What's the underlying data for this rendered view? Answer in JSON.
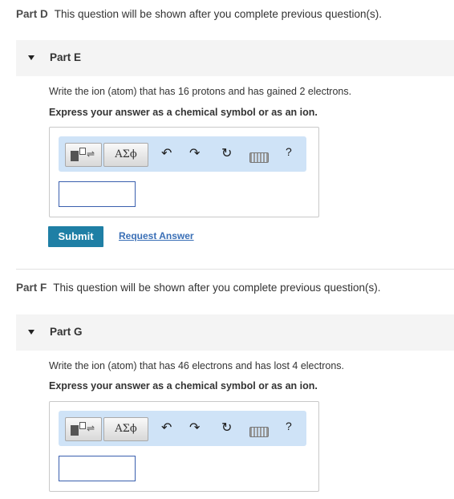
{
  "part_d": {
    "label": "Part D",
    "text": "This question will be shown after you complete previous question(s)."
  },
  "part_e": {
    "label": "Part E",
    "question": "Write the ion (atom) that has 16 protons and has gained 2 electrons.",
    "instruction": "Express your answer as a chemical symbol or as an ion.",
    "answer_value": "",
    "submit_label": "Submit",
    "request_label": "Request Answer"
  },
  "part_f": {
    "label": "Part F",
    "text": "This question will be shown after you complete previous question(s)."
  },
  "part_g": {
    "label": "Part G",
    "question": "Write the ion (atom) that has 46 electrons and has lost 4 electrons.",
    "instruction": "Express your answer as a chemical symbol or as an ion.",
    "answer_value": ""
  },
  "toolbar": {
    "greek_label": "ΑΣϕ",
    "undo_glyph": "↶",
    "redo_glyph": "↷",
    "reset_glyph": "↻",
    "help_label": "?",
    "icons": [
      "templates-icon",
      "greek-icon",
      "undo-icon",
      "redo-icon",
      "reset-icon",
      "keyboard-icon",
      "help-icon"
    ]
  },
  "colors": {
    "submit_bg": "#1f7fa5",
    "link": "#3a6fb6",
    "toolbar_bg": "#cfe3f7",
    "header_bg": "#f4f4f4"
  }
}
